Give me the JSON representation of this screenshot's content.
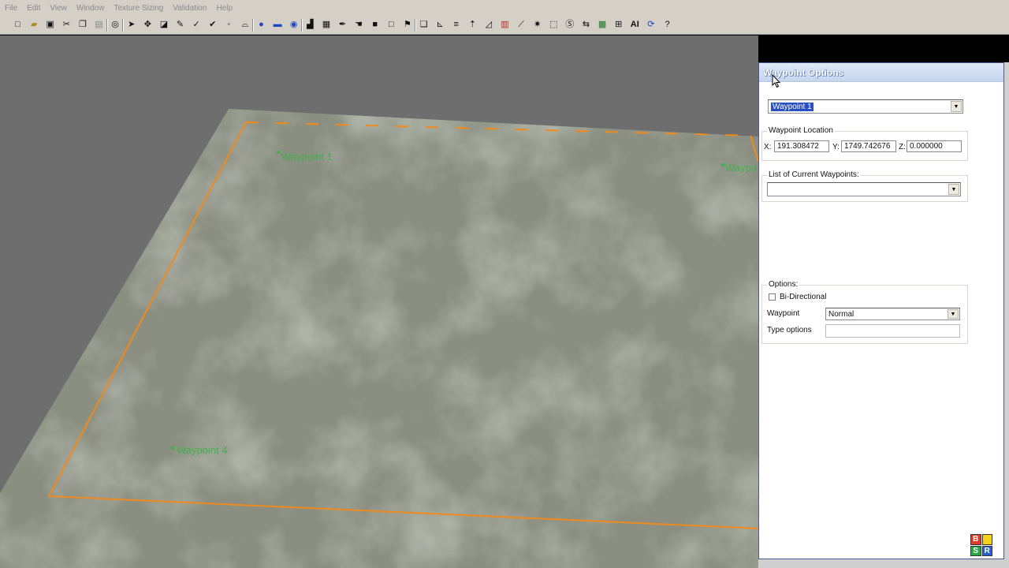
{
  "menu": [
    "File",
    "Edit",
    "View",
    "Window",
    "Texture Sizing",
    "Validation",
    "Help"
  ],
  "toolbar": {
    "icons": [
      {
        "name": "new-file-icon",
        "glyph": "□",
        "color": "#111"
      },
      {
        "name": "open-folder-icon",
        "glyph": "▰",
        "color": "#b08a20"
      },
      {
        "name": "save-icon",
        "glyph": "▣",
        "color": "#111"
      },
      {
        "name": "cut-icon",
        "glyph": "✂",
        "color": "#111"
      },
      {
        "name": "copy-icon",
        "glyph": "❐",
        "color": "#111"
      },
      {
        "name": "paste-icon",
        "glyph": "▤",
        "color": "#888"
      },
      {
        "name": "target-icon",
        "glyph": "◎",
        "color": "#111"
      },
      {
        "name": "select-arrow-icon",
        "glyph": "➤",
        "color": "#111"
      },
      {
        "name": "move-icon",
        "glyph": "✥",
        "color": "#111"
      },
      {
        "name": "paint-bucket-icon",
        "glyph": "◪",
        "color": "#111"
      },
      {
        "name": "brush-icon",
        "glyph": "✎",
        "color": "#111"
      },
      {
        "name": "check-tool-icon",
        "glyph": "✓",
        "color": "#111"
      },
      {
        "name": "check-alt-icon",
        "glyph": "✔",
        "color": "#111"
      },
      {
        "name": "point-icon",
        "glyph": "•",
        "color": "#888"
      },
      {
        "name": "mound-icon",
        "glyph": "⌓",
        "color": "#111"
      },
      {
        "name": "blue-sphere-icon",
        "glyph": "●",
        "color": "#1c46c4"
      },
      {
        "name": "blue-rect-icon",
        "glyph": "▬",
        "color": "#1c46c4"
      },
      {
        "name": "blue-globe-icon",
        "glyph": "◉",
        "color": "#1c46c4"
      },
      {
        "name": "fill-square-icon",
        "glyph": "▟",
        "color": "#111"
      },
      {
        "name": "grid-icon",
        "glyph": "▦",
        "color": "#111"
      },
      {
        "name": "eyedropper-icon",
        "glyph": "✒",
        "color": "#111"
      },
      {
        "name": "hand-icon",
        "glyph": "☚",
        "color": "#111"
      },
      {
        "name": "black-square-icon",
        "glyph": "■",
        "color": "#111"
      },
      {
        "name": "outline-square-icon",
        "glyph": "□",
        "color": "#111"
      },
      {
        "name": "flag-icon",
        "glyph": "⚑",
        "color": "#111"
      },
      {
        "name": "layers-icon",
        "glyph": "❏",
        "color": "#111"
      },
      {
        "name": "axis-icon",
        "glyph": "⊾",
        "color": "#111"
      },
      {
        "name": "lines-icon",
        "glyph": "≡",
        "color": "#111"
      },
      {
        "name": "tree-icon",
        "glyph": "⇡",
        "color": "#111"
      },
      {
        "name": "ramp-icon",
        "glyph": "◿",
        "color": "#111"
      },
      {
        "name": "fence-icon",
        "glyph": "▥",
        "color": "#b8281c"
      },
      {
        "name": "line-tool-icon",
        "glyph": "⟋",
        "color": "#111"
      },
      {
        "name": "gear-icon",
        "glyph": "✷",
        "color": "#111"
      },
      {
        "name": "scale-icon",
        "glyph": "⬚",
        "color": "#111"
      },
      {
        "name": "text-tool-icon",
        "glyph": "Ⓢ",
        "color": "#111"
      },
      {
        "name": "path-icon",
        "glyph": "⇆",
        "color": "#111"
      },
      {
        "name": "terrain-icon",
        "glyph": "▩",
        "color": "#1f7a2a"
      },
      {
        "name": "network-icon",
        "glyph": "⊞",
        "color": "#111"
      },
      {
        "name": "ai-icon",
        "glyph": "AI",
        "color": "#111"
      },
      {
        "name": "refresh-icon",
        "glyph": "⟳",
        "color": "#1c46c4"
      },
      {
        "name": "help-icon",
        "glyph": "?",
        "color": "#111"
      }
    ]
  },
  "viewport": {
    "labels": [
      {
        "text": "Waypoint 1"
      },
      {
        "text": "Waypo"
      },
      {
        "text": "Waypoint 4"
      }
    ],
    "colors": {
      "boundary": "#f08a1c",
      "waypoint_label": "#3fb04a"
    }
  },
  "panel": {
    "title": "Waypoint Options",
    "selected_waypoint": "Waypoint 1",
    "location": {
      "group_title": "Waypoint Location",
      "x_label": "X:",
      "x_value": "191.308472",
      "y_label": "Y:",
      "y_value": "1749.742676",
      "z_label": "Z:",
      "z_value": "0.000000"
    },
    "current_list": {
      "group_title": "List of Current Waypoints:",
      "value": ""
    },
    "options": {
      "group_title": "Options:",
      "bidirectional_label": "Bi-Directional",
      "bidirectional_checked": false,
      "waypoint_label": "Waypoint",
      "waypoint_value": "Normal",
      "type_options_label": "Type options",
      "type_options_value": ""
    },
    "logo_letters": [
      "B",
      "",
      "S",
      "R"
    ]
  }
}
